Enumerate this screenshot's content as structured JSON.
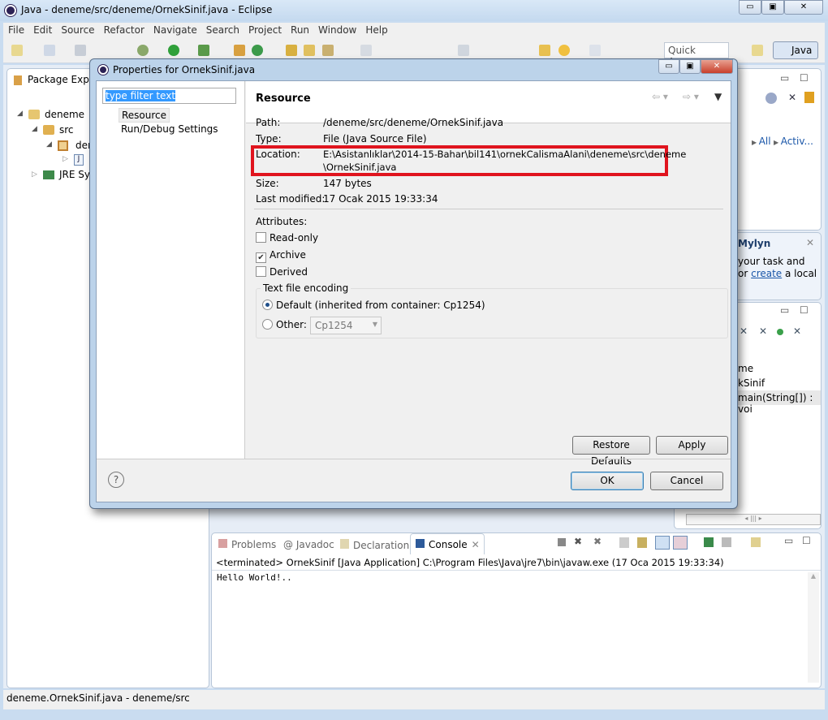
{
  "window": {
    "title": "Java - deneme/src/deneme/OrnekSinif.java - Eclipse",
    "controls": [
      "minimize",
      "maximize",
      "close"
    ]
  },
  "menu": [
    "File",
    "Edit",
    "Source",
    "Refactor",
    "Navigate",
    "Search",
    "Project",
    "Run",
    "Window",
    "Help"
  ],
  "toolbar": {
    "quick_access": "Quick Access",
    "perspective": "Java"
  },
  "package_explorer": {
    "title": "Package Explo",
    "tree": [
      {
        "label": "deneme"
      },
      {
        "label": "src"
      },
      {
        "label": "dene"
      },
      {
        "label": ""
      },
      {
        "label": "JRE Sys"
      }
    ]
  },
  "right_panels": {
    "task_links": [
      "All",
      "Activ..."
    ],
    "mylyn_title": "Mylyn",
    "mylyn_text1": "your task and",
    "mylyn_text2_pre": "or ",
    "mylyn_link": "create",
    "mylyn_text2_post": " a local",
    "outline": [
      "me",
      "kSinif",
      "main(String[]) : voi"
    ]
  },
  "console": {
    "tabs": [
      "Problems",
      "Javadoc",
      "Declaration",
      "Console"
    ],
    "active_tab": "Console",
    "header": "<terminated> OrnekSinif [Java Application] C:\\Program Files\\Java\\jre7\\bin\\javaw.exe (17 Oca 2015 19:33:34)",
    "output": "Hello World!.."
  },
  "statusbar": {
    "text": "deneme.OrnekSinif.java - deneme/src"
  },
  "dialog": {
    "title": "Properties for OrnekSinif.java",
    "filter_placeholder": "type filter text",
    "nav": [
      "Resource",
      "Run/Debug Settings"
    ],
    "selected_nav": "Resource",
    "section_title": "Resource",
    "fields": {
      "path_label": "Path:",
      "path": "/deneme/src/deneme/OrnekSinif.java",
      "type_label": "Type:",
      "type": "File  (Java Source File)",
      "location_label": "Location:",
      "location_line1": "E:\\Asistanlıklar\\2014-15-Bahar\\bil141\\ornekCalismaAlani\\deneme\\src\\deneme",
      "location_line2": "\\OrnekSinif.java",
      "size_label": "Size:",
      "size": "147  bytes",
      "modified_label": "Last modified:",
      "modified": "17 Ocak 2015 19:33:34"
    },
    "attributes_label": "Attributes:",
    "attributes": [
      {
        "label": "Read-only",
        "checked": false
      },
      {
        "label": "Archive",
        "checked": true
      },
      {
        "label": "Derived",
        "checked": false
      }
    ],
    "encoding": {
      "group": "Text file encoding",
      "default_label": "Default (inherited from container: Cp1254)",
      "other_label": "Other:",
      "other_value": "Cp1254",
      "selected": "default"
    },
    "buttons": {
      "restore": "Restore Defaults",
      "apply": "Apply",
      "ok": "OK",
      "cancel": "Cancel",
      "help": "?"
    },
    "highlight_color": "#e0141e"
  }
}
